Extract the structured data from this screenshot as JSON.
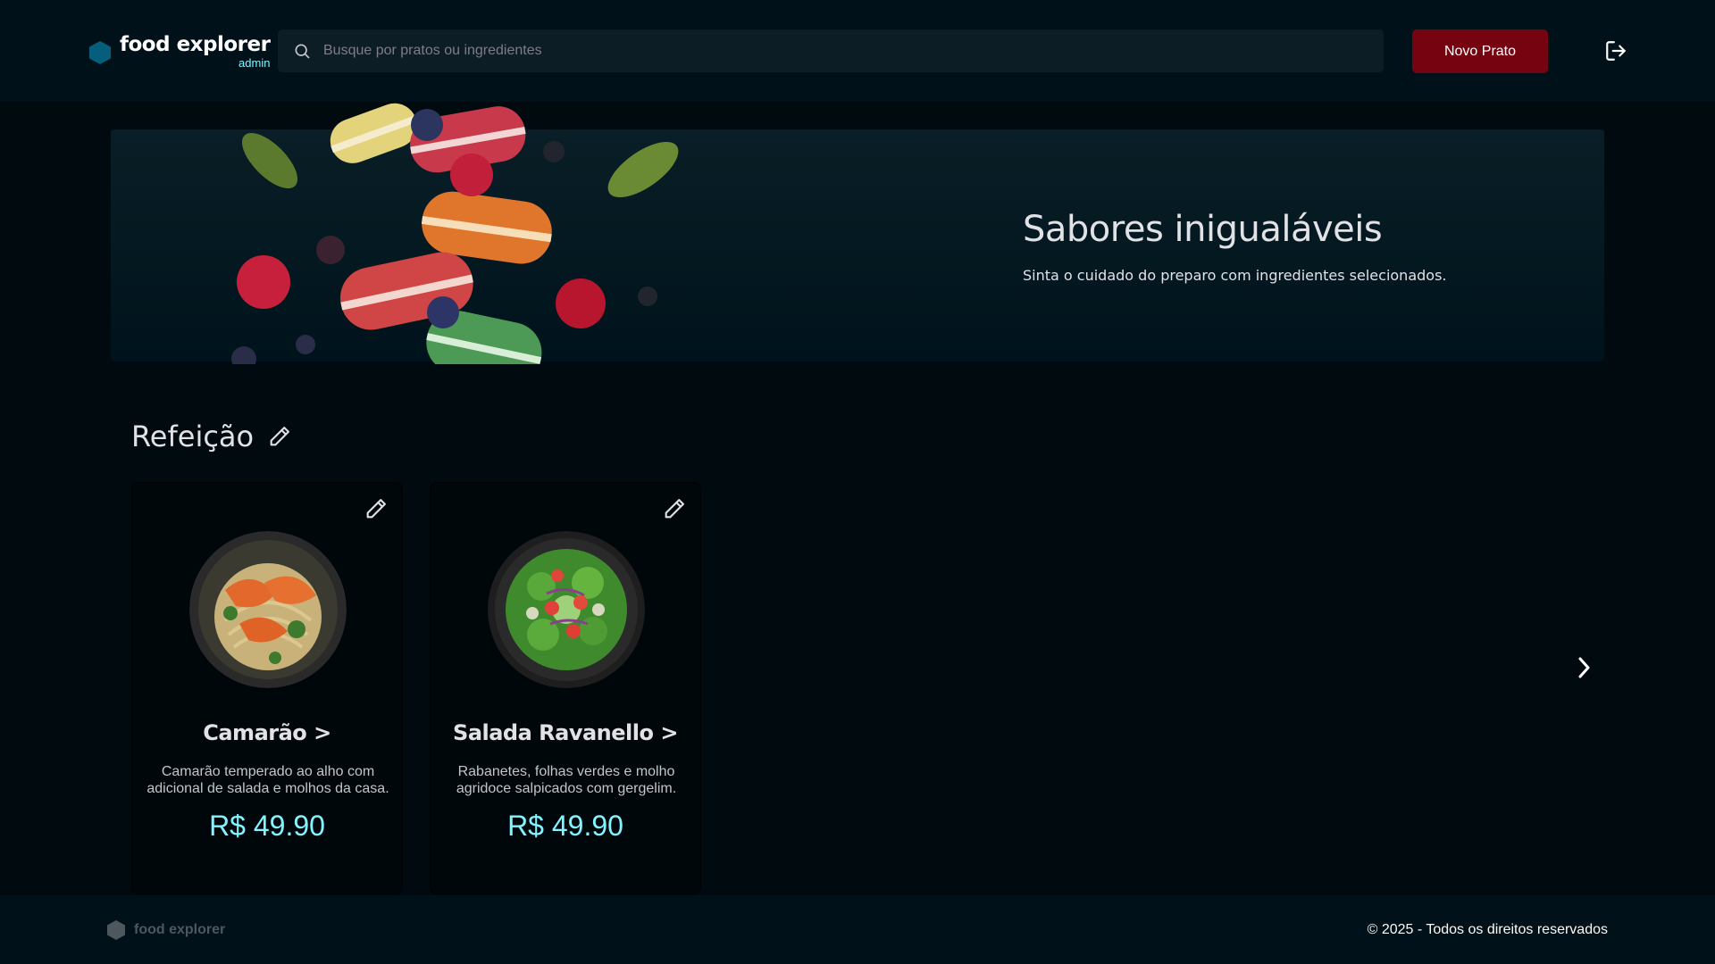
{
  "header": {
    "brand_name": "food explorer",
    "brand_role": "admin",
    "search_placeholder": "Busque por pratos ou ingredientes",
    "search_value": "",
    "new_dish_label": "Novo Prato",
    "logout_icon": "sign-out-icon"
  },
  "banner": {
    "title": "Sabores inigualáveis",
    "subtitle": "Sinta o cuidado do preparo com ingredientes selecionados."
  },
  "section": {
    "title": "Refeição",
    "edit_icon": "pencil-icon"
  },
  "cards": [
    {
      "name": "Camarão >",
      "description": "Camarão temperado ao alho com adicional de salada e molhos da casa.",
      "price": "R$ 49.90"
    },
    {
      "name": "Salada Ravanello >",
      "description": "Rabanetes, folhas verdes e molho agridoce salpicados com gergelim.",
      "price": "R$ 49.90"
    }
  ],
  "footer": {
    "brand_name": "food explorer",
    "copyright": "© 2025 - Todos os direitos reservados"
  },
  "colors": {
    "accent": "#82f3ff",
    "primary_button": "#750310",
    "header_bg": "#00111a",
    "page_bg": "#000a0f"
  }
}
